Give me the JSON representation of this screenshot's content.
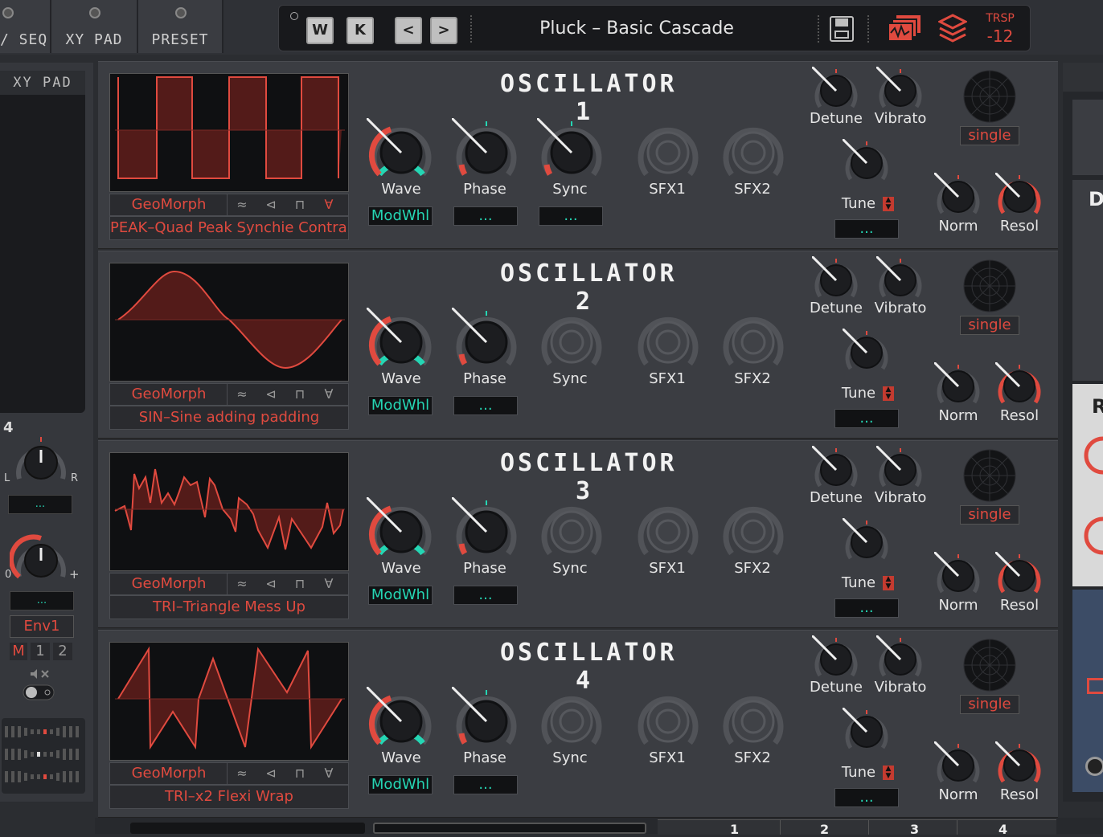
{
  "nav": {
    "tab1": "/ SEQ",
    "tab2": "XY PAD",
    "tab3": "PRESET"
  },
  "toolbar": {
    "btn_w": "W",
    "btn_k": "K",
    "btn_prev": "<",
    "btn_next": ">",
    "preset_name": "Pluck – Basic Cascade",
    "trsp_label": "TRSP",
    "trsp_value": "-12"
  },
  "left": {
    "xy_title": "XY PAD",
    "num4": "4",
    "L": "L",
    "R": "R",
    "dots1": "...",
    "zero": "0",
    "plus": "+",
    "dots2": "...",
    "env": "Env1",
    "m": "M",
    "one": "1",
    "two": "2"
  },
  "right": {
    "D": "D",
    "R": "R"
  },
  "oscillators": [
    {
      "title": "OSCILLATOR 1",
      "geo": "GeoMorph",
      "wave_name": "PEAK–Quad Peak Synchie Contrar",
      "wave": "Wave",
      "phase": "Phase",
      "sync": "Sync",
      "sfx1": "SFX1",
      "sfx2": "SFX2",
      "mod_wave": "ModWhl",
      "mod_phase": "...",
      "mod_sync": "...",
      "detune": "Detune",
      "vibrato": "Vibrato",
      "tune": "Tune",
      "tune_mod": "...",
      "single": "single",
      "norm": "Norm",
      "resol": "Resol"
    },
    {
      "title": "OSCILLATOR 2",
      "geo": "GeoMorph",
      "wave_name": "SIN–Sine adding padding",
      "wave": "Wave",
      "phase": "Phase",
      "sync": "Sync",
      "sfx1": "SFX1",
      "sfx2": "SFX2",
      "mod_wave": "ModWhl",
      "mod_phase": "...",
      "detune": "Detune",
      "vibrato": "Vibrato",
      "tune": "Tune",
      "tune_mod": "...",
      "single": "single",
      "norm": "Norm",
      "resol": "Resol"
    },
    {
      "title": "OSCILLATOR 3",
      "geo": "GeoMorph",
      "wave_name": "TRI–Triangle Mess Up",
      "wave": "Wave",
      "phase": "Phase",
      "sync": "Sync",
      "sfx1": "SFX1",
      "sfx2": "SFX2",
      "mod_wave": "ModWhl",
      "mod_phase": "...",
      "detune": "Detune",
      "vibrato": "Vibrato",
      "tune": "Tune",
      "tune_mod": "...",
      "single": "single",
      "norm": "Norm",
      "resol": "Resol"
    },
    {
      "title": "OSCILLATOR 4",
      "geo": "GeoMorph",
      "wave_name": "TRI–x2 Flexi Wrap",
      "wave": "Wave",
      "phase": "Phase",
      "sync": "Sync",
      "sfx1": "SFX1",
      "sfx2": "SFX2",
      "mod_wave": "ModWhl",
      "mod_phase": "...",
      "detune": "Detune",
      "vibrato": "Vibrato",
      "tune": "Tune",
      "tune_mod": "...",
      "single": "single",
      "norm": "Norm",
      "resol": "Resol"
    }
  ],
  "bottom": {
    "n1": "1",
    "n2": "2",
    "n3": "3",
    "n4": "4"
  },
  "colors": {
    "accent_red": "#e04a3f",
    "accent_teal": "#25d6b4",
    "panel": "#3b3d42"
  }
}
